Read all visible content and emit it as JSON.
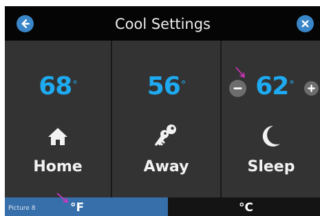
{
  "header": {
    "title": "Cool Settings",
    "back_icon": "arrow-left-icon",
    "close_icon": "close-icon",
    "accent": "#3a86c8"
  },
  "modes": [
    {
      "label": "Home",
      "temp": "68",
      "degree": "°",
      "icon": "home-icon"
    },
    {
      "label": "Away",
      "temp": "56",
      "degree": "°",
      "icon": "keys-icon"
    },
    {
      "label": "Sleep",
      "temp": "62",
      "degree": "°",
      "icon": "moon-icon"
    }
  ],
  "sleep_stepper": {
    "minus_icon": "minus-icon",
    "plus_icon": "plus-icon"
  },
  "units": {
    "fahrenheit": "°F",
    "celsius": "°C",
    "selected": "fahrenheit",
    "selected_color": "#366fa9"
  },
  "annotation": {
    "caption": "Picture 8",
    "arrow_color": "#d633c4"
  },
  "colors": {
    "temperature": "#1eaaf1",
    "panel": "#333333",
    "header": "#050505"
  }
}
